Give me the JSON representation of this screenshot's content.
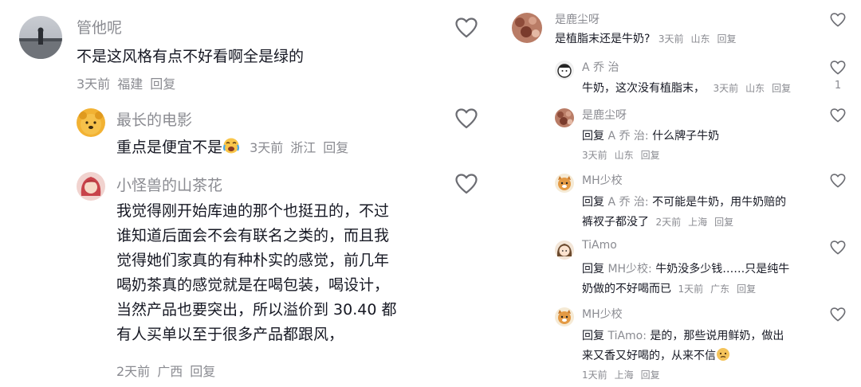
{
  "left_comments": [
    {
      "username": "管他呢",
      "text": "不是这风格有点不好看啊全是绿的",
      "time": "3天前",
      "location": "福建",
      "reply_label": "回复",
      "avatar_icon": "scenic-person-avatar"
    },
    {
      "username": "最长的电影",
      "text": "重点是便宜不是",
      "emoji": "crying-laughing-emoji",
      "time": "3天前",
      "location": "浙江",
      "reply_label": "回复",
      "avatar_icon": "winnie-pooh-avatar"
    },
    {
      "username": "小怪兽的山茶花",
      "lines": [
        "我觉得刚开始库迪的那个也挺丑的，不过",
        "谁知道后面会不会有联名之类的，而且我",
        "觉得她们家真的有种朴实的感觉，前几年",
        "喝奶茶真的感觉就是在喝包装，喝设计，",
        "当然产品也要突出，所以溢价到 30.40 都",
        "有人买单以至于很多产品都跟风，"
      ],
      "time": "2天前",
      "location": "广西",
      "reply_label": "回复",
      "avatar_icon": "princess-avatar"
    }
  ],
  "right_comments": [
    {
      "username": "是鹿尘呀",
      "text": "是植脂末还是牛奶?",
      "time": "3天前",
      "location": "山东",
      "reply_label": "回复",
      "avatar_icon": "food-avatar"
    },
    {
      "username": "A 乔 治",
      "text": "牛奶，这次没有植脂末，",
      "time": "3天前",
      "location": "山东",
      "reply_label": "回复",
      "like_count": "1",
      "avatar_icon": "cartoon-face-avatar"
    },
    {
      "username": "是鹿尘呀",
      "reply_prefix": "回复",
      "reply_to": "A 乔 治:",
      "text": "什么牌子牛奶",
      "time": "3天前",
      "location": "山东",
      "reply_label": "回复",
      "avatar_icon": "food-avatar"
    },
    {
      "username": "MH少校",
      "reply_prefix": "回复",
      "reply_to": "A 乔 治:",
      "lines": [
        "不可能是牛奶，用牛奶赔的",
        "裤衩子都没了"
      ],
      "time": "2天前",
      "location": "上海",
      "reply_label": "回复",
      "avatar_icon": "cat-avatar"
    },
    {
      "username": "TiAmo",
      "reply_prefix": "回复",
      "reply_to": "MH少校:",
      "lines": [
        "牛奶没多少钱……只是纯牛",
        "奶做的不好喝而已"
      ],
      "time": "1天前",
      "location": "广东",
      "reply_label": "回复",
      "avatar_icon": "cartoon-girl-avatar"
    },
    {
      "username": "MH少校",
      "reply_prefix": "回复",
      "reply_to": "TiAmo:",
      "lines": [
        "是的，那些说用鲜奶，做出",
        "来又香又好喝的，从来不信"
      ],
      "emoji": "doubtful-emoji",
      "time": "1天前",
      "location": "上海",
      "reply_label": "回复",
      "avatar_icon": "cat-avatar"
    }
  ],
  "colors": {
    "text": "#161823",
    "meta": "#8a8b91",
    "heart": "#6b6c72"
  }
}
